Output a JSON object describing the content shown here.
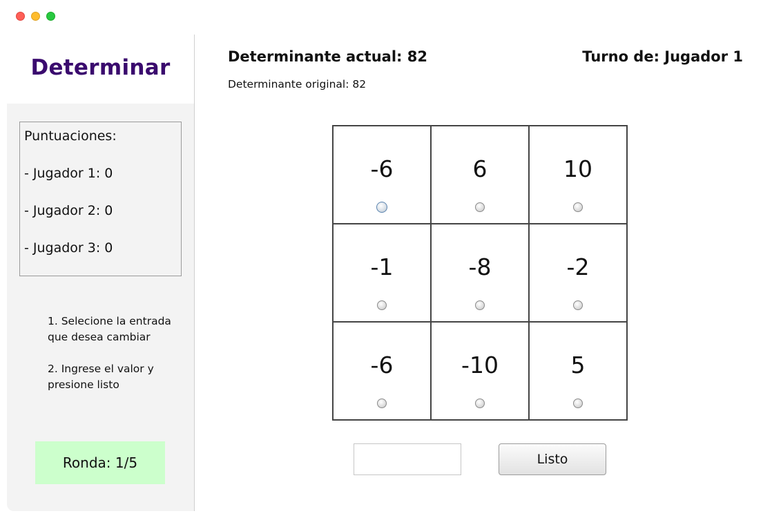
{
  "app": {
    "title": "Determinar"
  },
  "window_controls": {
    "close_color": "#fe5f57",
    "minimize_color": "#febc2e",
    "zoom_color": "#28c840"
  },
  "scores": {
    "title": "Puntuaciones:",
    "lines": [
      "- Jugador 1: 0",
      "- Jugador 2: 0",
      "- Jugador 3: 0"
    ]
  },
  "instructions": {
    "step1": "1. Selecione la entrada que desea cambiar",
    "step2": "2. Ingrese el valor y presione listo"
  },
  "round": {
    "label": "Ronda: 1/5"
  },
  "header": {
    "current_determinant": "Determinante actual: 82",
    "turn": "Turno de: Jugador 1",
    "original_determinant": "Determinante original: 82"
  },
  "matrix": {
    "cells": [
      "-6",
      "6",
      "10",
      "-1",
      "-8",
      "-2",
      "-6",
      "-10",
      "5"
    ],
    "selected_index": 0
  },
  "input": {
    "value": ""
  },
  "button": {
    "label": "Listo"
  },
  "colors": {
    "title": "#3a0a6e",
    "round_bg": "#ccffcc",
    "sidebar_bg": "#f3f3f3"
  }
}
